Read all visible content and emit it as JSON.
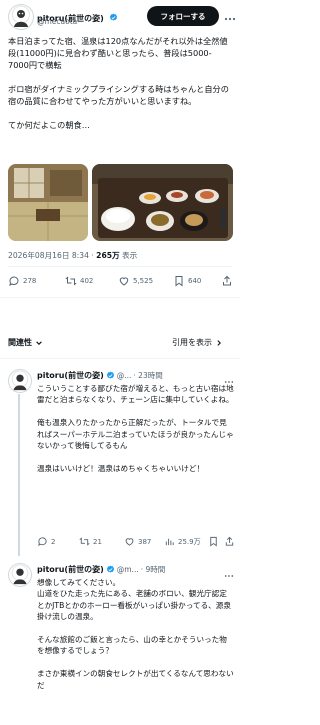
{
  "author": {
    "name": "pitoru(前世の姿)",
    "handle": "@mecaota"
  },
  "follow_button": "フォローする",
  "post": {
    "text": "本日泊まってた宿、温泉は120点なんだがそれ以外は全然値段(11000円)に見合わず酷いと思ったら、普段は5000-7000円で横転\n\nボロ宿がダイナミックプライシングする時はちゃんと自分の宿の品質に合わせてやった方がいいと思いますね。\n\nてか何だよこの朝食…",
    "timestamp": "2026年08月16日 8:34",
    "views_count": "265万",
    "views_label": "表示",
    "stats": {
      "replies": "278",
      "reposts": "402",
      "likes": "5,525",
      "bookmarks": "640"
    }
  },
  "reply_bar": {
    "sort_label": "関連性",
    "quote_label": "引用を表示"
  },
  "replies": [
    {
      "name": "pitoru(前世の姿)",
      "handle": "@...",
      "time": "· 23時間",
      "text": "こういうことする鄙びた宿が増えると、もっと古い宿は地雷だと泊まらなくなり、チェーン店に集中していくよね。\n\n俺も温泉入りたかったから正解だったが、トータルで見ればスーパーホテル二泊まっていたほうが良かったんじゃないかって後悔してるもん\n\n温泉はいいけど！温泉はめちゃくちゃいいけど！",
      "stats": {
        "replies": "2",
        "reposts": "21",
        "likes": "387",
        "views": "25.9万"
      }
    },
    {
      "name": "pitoru(前世の姿)",
      "handle": "@m...",
      "time": "· 9時間",
      "text": "想像してみてください。\n山道をひた走った先にある、老舗のボロい、観光庁認定とかJTBとかのホーロー看板がいっぱい掛かってる、源泉掛け流しの温泉。\n\nそんな旅館のご飯と言ったら、山の幸とかそういった物を想像するでしょう？\n\nまさか東横インの朝食セレクトが出てくるなんて思わないだ"
    }
  ],
  "colors": {
    "accent": "#1d9bf0",
    "text": "#0f1419",
    "muted": "#536471",
    "divider": "#eff3f4"
  }
}
